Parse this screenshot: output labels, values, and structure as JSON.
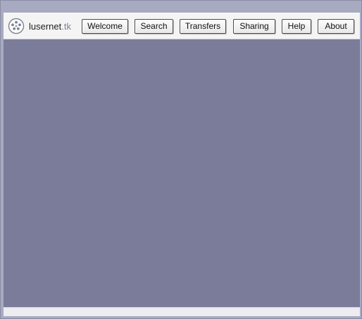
{
  "app": {
    "logo_name": "lusernet",
    "logo_suffix": ".tk"
  },
  "nav": [
    {
      "id": "welcome",
      "label": "Welcome"
    },
    {
      "id": "search",
      "label": "Search"
    },
    {
      "id": "transfers",
      "label": "Transfers"
    },
    {
      "id": "sharing",
      "label": "Sharing"
    },
    {
      "id": "help",
      "label": "Help"
    },
    {
      "id": "about",
      "label": "About"
    }
  ],
  "icons": {
    "logo": "people-network-icon"
  },
  "colors": {
    "frame": "#a8aac2",
    "toolbar": "#f4f4f4",
    "content": "#7b7c99",
    "statusbar": "#ececf1"
  }
}
